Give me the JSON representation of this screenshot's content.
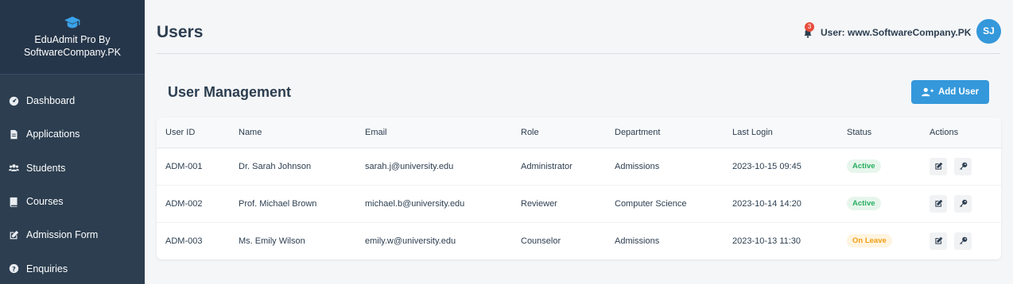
{
  "sidebar": {
    "brand_line1": "EduAdmit Pro By",
    "brand_line2": "SoftwareCompany.PK",
    "items": [
      {
        "label": "Dashboard",
        "icon": "dashboard-icon"
      },
      {
        "label": "Applications",
        "icon": "file-icon"
      },
      {
        "label": "Students",
        "icon": "users-icon"
      },
      {
        "label": "Courses",
        "icon": "book-icon"
      },
      {
        "label": "Admission Form",
        "icon": "edit-icon"
      },
      {
        "label": "Enquiries",
        "icon": "question-icon"
      }
    ]
  },
  "header": {
    "title": "Users",
    "notification_count": "3",
    "user_label": "User: www.SoftwareCompany.PK",
    "avatar_initials": "SJ"
  },
  "section": {
    "title": "User Management",
    "add_button": "Add User"
  },
  "table": {
    "columns": [
      "User ID",
      "Name",
      "Email",
      "Role",
      "Department",
      "Last Login",
      "Status",
      "Actions"
    ],
    "rows": [
      {
        "id": "ADM-001",
        "name": "Dr. Sarah Johnson",
        "email": "sarah.j@university.edu",
        "role": "Administrator",
        "department": "Admissions",
        "last_login": "2023-10-15 09:45",
        "status": "Active"
      },
      {
        "id": "ADM-002",
        "name": "Prof. Michael Brown",
        "email": "michael.b@university.edu",
        "role": "Reviewer",
        "department": "Computer Science",
        "last_login": "2023-10-14 14:20",
        "status": "Active"
      },
      {
        "id": "ADM-003",
        "name": "Ms. Emily Wilson",
        "email": "emily.w@university.edu",
        "role": "Counselor",
        "department": "Admissions",
        "last_login": "2023-10-13 11:30",
        "status": "On Leave"
      }
    ]
  },
  "colors": {
    "sidebar_bg": "#2c3e50",
    "accent": "#3498db",
    "active_status": "#27ae60",
    "leave_status": "#f39c12",
    "notification_badge": "#e74c3c"
  }
}
